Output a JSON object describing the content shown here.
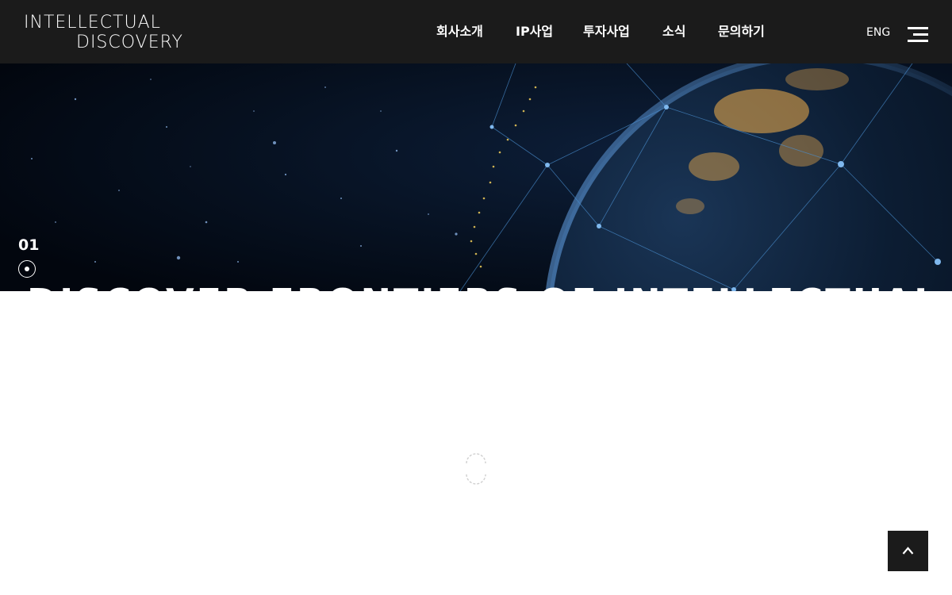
{
  "header": {
    "logo": {
      "line1": "INTELLECTUAL",
      "line2": "DISCOVERY"
    },
    "nav": [
      {
        "label": "회사소개"
      },
      {
        "label": "IP사업"
      },
      {
        "label": "투자사업"
      },
      {
        "label": "소식"
      },
      {
        "label": "문의하기"
      }
    ],
    "lang_label": "ENG",
    "menu_icon": "hamburger-icon"
  },
  "hero": {
    "slide_number": "01",
    "title": "DISCOVER FRONTIERS OF INTELLECTUAL PROPERTY",
    "background": "earth-network-image"
  },
  "loading_icon": "spinner-icon",
  "top_button_icon": "chevron-up-icon",
  "colors": {
    "header_bg": "#1b1b1b",
    "hero_bg": "#040b18",
    "text_light": "#ffffff",
    "network_blue": "#4a8fd0",
    "city_lights": "#f5b04a"
  }
}
